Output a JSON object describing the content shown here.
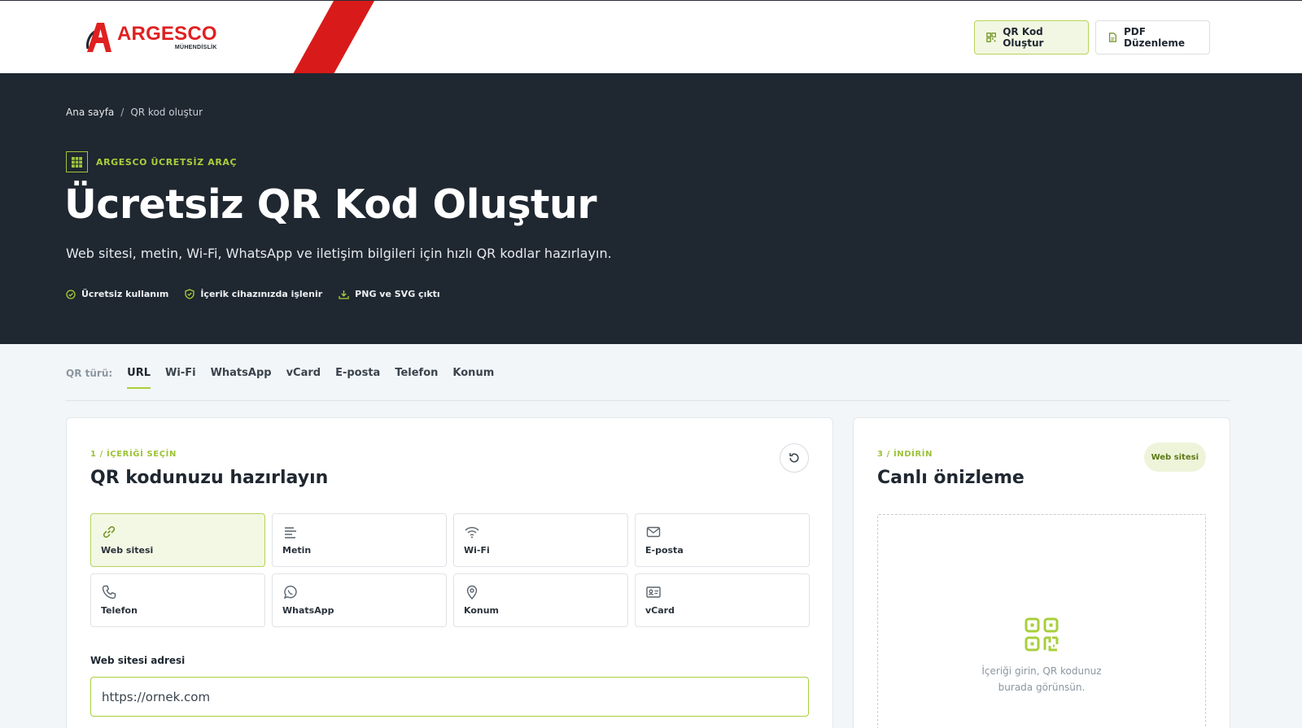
{
  "brand": {
    "name": "ARGESCO",
    "subtitle": "MÜHENDİSLİK"
  },
  "header": {
    "buttons": [
      {
        "label": "QR Kod Oluştur",
        "icon": "qr-icon",
        "active": true
      },
      {
        "label": "PDF Düzenleme",
        "icon": "pdf-icon",
        "active": false
      }
    ]
  },
  "breadcrumb": {
    "home": "Ana sayfa",
    "separator": "/",
    "current": "QR kod oluştur"
  },
  "hero": {
    "eyebrow": "ARGESCO ÜCRETSİZ ARAÇ",
    "title": "Ücretsiz QR Kod Oluştur",
    "subtitle": "Web sitesi, metin, Wi-Fi, WhatsApp ve iletişim bilgileri için hızlı QR kodlar hazırlayın.",
    "features": [
      {
        "label": "Ücretsiz kullanım",
        "icon": "check-circle-icon"
      },
      {
        "label": "İçerik cihazınızda işlenir",
        "icon": "shield-check-icon"
      },
      {
        "label": "PNG ve SVG çıktı",
        "icon": "download-icon"
      }
    ]
  },
  "tabs": {
    "label": "QR türü:",
    "items": [
      "URL",
      "Wi-Fi",
      "WhatsApp",
      "vCard",
      "E-posta",
      "Telefon",
      "Konum"
    ],
    "active": "URL"
  },
  "editor": {
    "step": "1 / İÇERİĞİ SEÇİN",
    "title": "QR kodunuzu hazırlayın",
    "types": [
      {
        "label": "Web sitesi",
        "icon": "link-icon",
        "active": true
      },
      {
        "label": "Metin",
        "icon": "text-icon",
        "active": false
      },
      {
        "label": "Wi-Fi",
        "icon": "wifi-icon",
        "active": false
      },
      {
        "label": "E-posta",
        "icon": "mail-icon",
        "active": false
      },
      {
        "label": "Telefon",
        "icon": "phone-icon",
        "active": false
      },
      {
        "label": "WhatsApp",
        "icon": "whatsapp-icon",
        "active": false
      },
      {
        "label": "Konum",
        "icon": "location-icon",
        "active": false
      },
      {
        "label": "vCard",
        "icon": "contact-card-icon",
        "active": false
      }
    ],
    "field_label": "Web sitesi adresi",
    "field_placeholder": "https://ornek.com"
  },
  "preview": {
    "step": "3 / İNDİRİN",
    "title": "Canlı önizleme",
    "badge": "Web sitesi",
    "empty_line1": "İçeriği girin, QR kodunuz",
    "empty_line2": "burada görünsün."
  },
  "colors": {
    "accent": "#a8cf3c",
    "brand_red": "#e02020",
    "hero_bg": "#1f2730"
  }
}
